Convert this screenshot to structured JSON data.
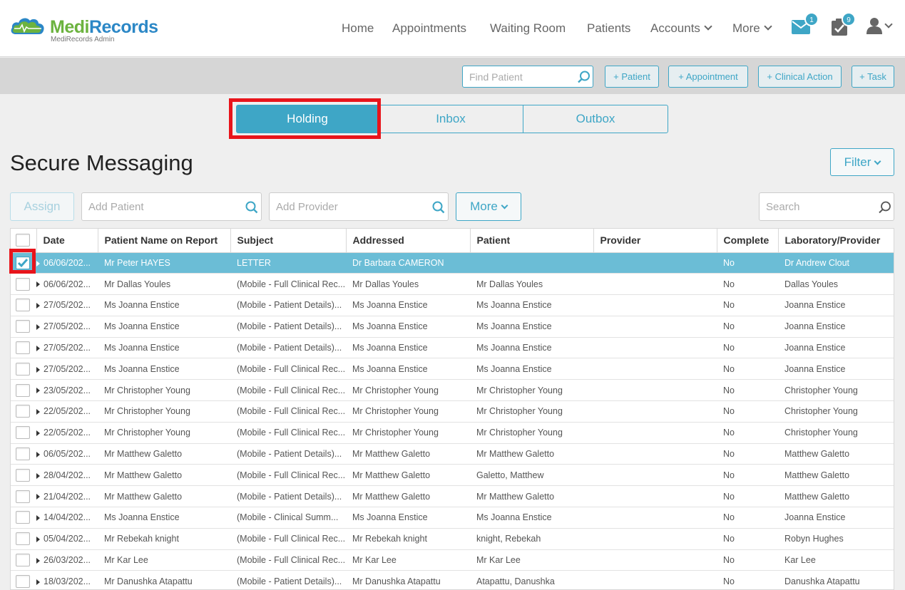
{
  "brand": {
    "name_part1": "Medi",
    "name_part2": "Records",
    "subtitle": "MediRecords Admin"
  },
  "nav": {
    "home": "Home",
    "appointments": "Appointments",
    "waiting_room": "Waiting Room",
    "patients": "Patients",
    "accounts": "Accounts",
    "more": "More",
    "messages_badge": "1",
    "tasks_badge": "9"
  },
  "actionbar": {
    "find_patient_placeholder": "Find Patient",
    "add_patient": "+ Patient",
    "add_appointment": "+ Appointment",
    "add_clinical_action": "+ Clinical Action",
    "add_task": "+ Task"
  },
  "tabs": {
    "holding": "Holding",
    "inbox": "Inbox",
    "outbox": "Outbox",
    "active": "Holding"
  },
  "page": {
    "title": "Secure Messaging",
    "filter": "Filter"
  },
  "toolbar": {
    "assign": "Assign",
    "add_patient_placeholder": "Add Patient",
    "add_provider_placeholder": "Add Provider",
    "more": "More",
    "search_placeholder": "Search"
  },
  "table": {
    "columns": [
      "Date",
      "Patient Name on Report",
      "Subject",
      "Addressed",
      "Patient",
      "Provider",
      "Complete",
      "Laboratory/Provider"
    ],
    "rows": [
      {
        "date": "06/06/202...",
        "name": "Mr Peter HAYES",
        "subject": "LETTER",
        "addressed": "Dr Barbara CAMERON",
        "patient": "",
        "provider": "",
        "complete": "No",
        "lab": "Dr Andrew Clout",
        "selected": true
      },
      {
        "date": "06/06/202...",
        "name": "Mr Dallas Youles",
        "subject": "(Mobile - Full Clinical Rec...",
        "addressed": "Mr Dallas Youles",
        "patient": "Mr Dallas Youles",
        "provider": "",
        "complete": "No",
        "lab": "Dallas Youles"
      },
      {
        "date": "27/05/202...",
        "name": "Ms Joanna Enstice",
        "subject": "(Mobile - Patient Details)...",
        "addressed": "Ms Joanna Enstice",
        "patient": "Ms Joanna Enstice",
        "provider": "",
        "complete": "No",
        "lab": "Joanna Enstice"
      },
      {
        "date": "27/05/202...",
        "name": "Ms Joanna Enstice",
        "subject": "(Mobile - Patient Details)...",
        "addressed": "Ms Joanna Enstice",
        "patient": "Ms Joanna Enstice",
        "provider": "",
        "complete": "No",
        "lab": "Joanna Enstice"
      },
      {
        "date": "27/05/202...",
        "name": "Ms Joanna Enstice",
        "subject": "(Mobile - Patient Details)...",
        "addressed": "Ms Joanna Enstice",
        "patient": "Ms Joanna Enstice",
        "provider": "",
        "complete": "No",
        "lab": "Joanna Enstice"
      },
      {
        "date": "27/05/202...",
        "name": "Ms Joanna Enstice",
        "subject": "(Mobile - Full Clinical Rec...",
        "addressed": "Ms Joanna Enstice",
        "patient": "Ms Joanna Enstice",
        "provider": "",
        "complete": "No",
        "lab": "Joanna Enstice"
      },
      {
        "date": "23/05/202...",
        "name": "Mr Christopher Young",
        "subject": "(Mobile - Full Clinical Rec...",
        "addressed": "Mr Christopher Young",
        "patient": "Mr Christopher Young",
        "provider": "",
        "complete": "No",
        "lab": "Christopher Young"
      },
      {
        "date": "22/05/202...",
        "name": "Mr Christopher Young",
        "subject": "(Mobile - Full Clinical Rec...",
        "addressed": "Mr Christopher Young",
        "patient": "Mr Christopher Young",
        "provider": "",
        "complete": "No",
        "lab": "Christopher Young"
      },
      {
        "date": "22/05/202...",
        "name": "Mr Christopher Young",
        "subject": "(Mobile - Full Clinical Rec...",
        "addressed": "Mr Christopher Young",
        "patient": "Mr Christopher Young",
        "provider": "",
        "complete": "No",
        "lab": "Christopher Young"
      },
      {
        "date": "06/05/202...",
        "name": "Mr Matthew Galetto",
        "subject": "(Mobile - Patient Details)...",
        "addressed": "Mr Matthew Galetto",
        "patient": "Mr Matthew Galetto",
        "provider": "",
        "complete": "No",
        "lab": "Matthew Galetto"
      },
      {
        "date": "28/04/202...",
        "name": "Mr Matthew Galetto",
        "subject": "(Mobile - Full Clinical Rec...",
        "addressed": "Mr Matthew Galetto",
        "patient": "Galetto, Matthew",
        "provider": "",
        "complete": "No",
        "lab": "Matthew Galetto"
      },
      {
        "date": "21/04/202...",
        "name": "Mr Matthew Galetto",
        "subject": "(Mobile - Patient Details)...",
        "addressed": "Mr Matthew Galetto",
        "patient": "Mr Matthew Galetto",
        "provider": "",
        "complete": "No",
        "lab": "Matthew Galetto"
      },
      {
        "date": "14/04/202...",
        "name": "Ms Joanna Enstice",
        "subject": "(Mobile - Clinical Summ...",
        "addressed": "Ms Joanna Enstice",
        "patient": "Ms Joanna Enstice",
        "provider": "",
        "complete": "No",
        "lab": "Joanna Enstice"
      },
      {
        "date": "05/04/202...",
        "name": "Mr Rebekah knight",
        "subject": "(Mobile - Full Clinical Rec...",
        "addressed": "Mr Rebekah knight",
        "patient": "knight, Rebekah",
        "provider": "",
        "complete": "No",
        "lab": "Robyn Hughes"
      },
      {
        "date": "26/03/202...",
        "name": "Mr Kar Lee",
        "subject": "(Mobile - Full Clinical Rec...",
        "addressed": "Mr Kar Lee",
        "patient": "Mr Kar Lee",
        "provider": "",
        "complete": "No",
        "lab": "Kar Lee"
      },
      {
        "date": "18/03/202...",
        "name": "Mr Danushka Atapattu",
        "subject": "(Mobile - Patient Details)...",
        "addressed": "Mr Danushka Atapattu",
        "patient": "Atapattu, Danushka",
        "provider": "",
        "complete": "No",
        "lab": "Danushka Atapattu"
      }
    ]
  },
  "colors": {
    "accent": "#3ea6c6",
    "selected_row": "#6bbdd6",
    "highlight": "#e8141b",
    "brand_green": "#6cb33f",
    "brand_blue": "#2b87c6"
  },
  "icons": {
    "logo": "cloud-heartbeat-icon",
    "messages": "envelope-icon",
    "tasks": "clipboard-check-icon",
    "user": "user-icon",
    "search": "search-icon",
    "dropdown": "chevron-down-icon",
    "expand": "caret-right-icon",
    "checked": "checkmark-icon"
  }
}
